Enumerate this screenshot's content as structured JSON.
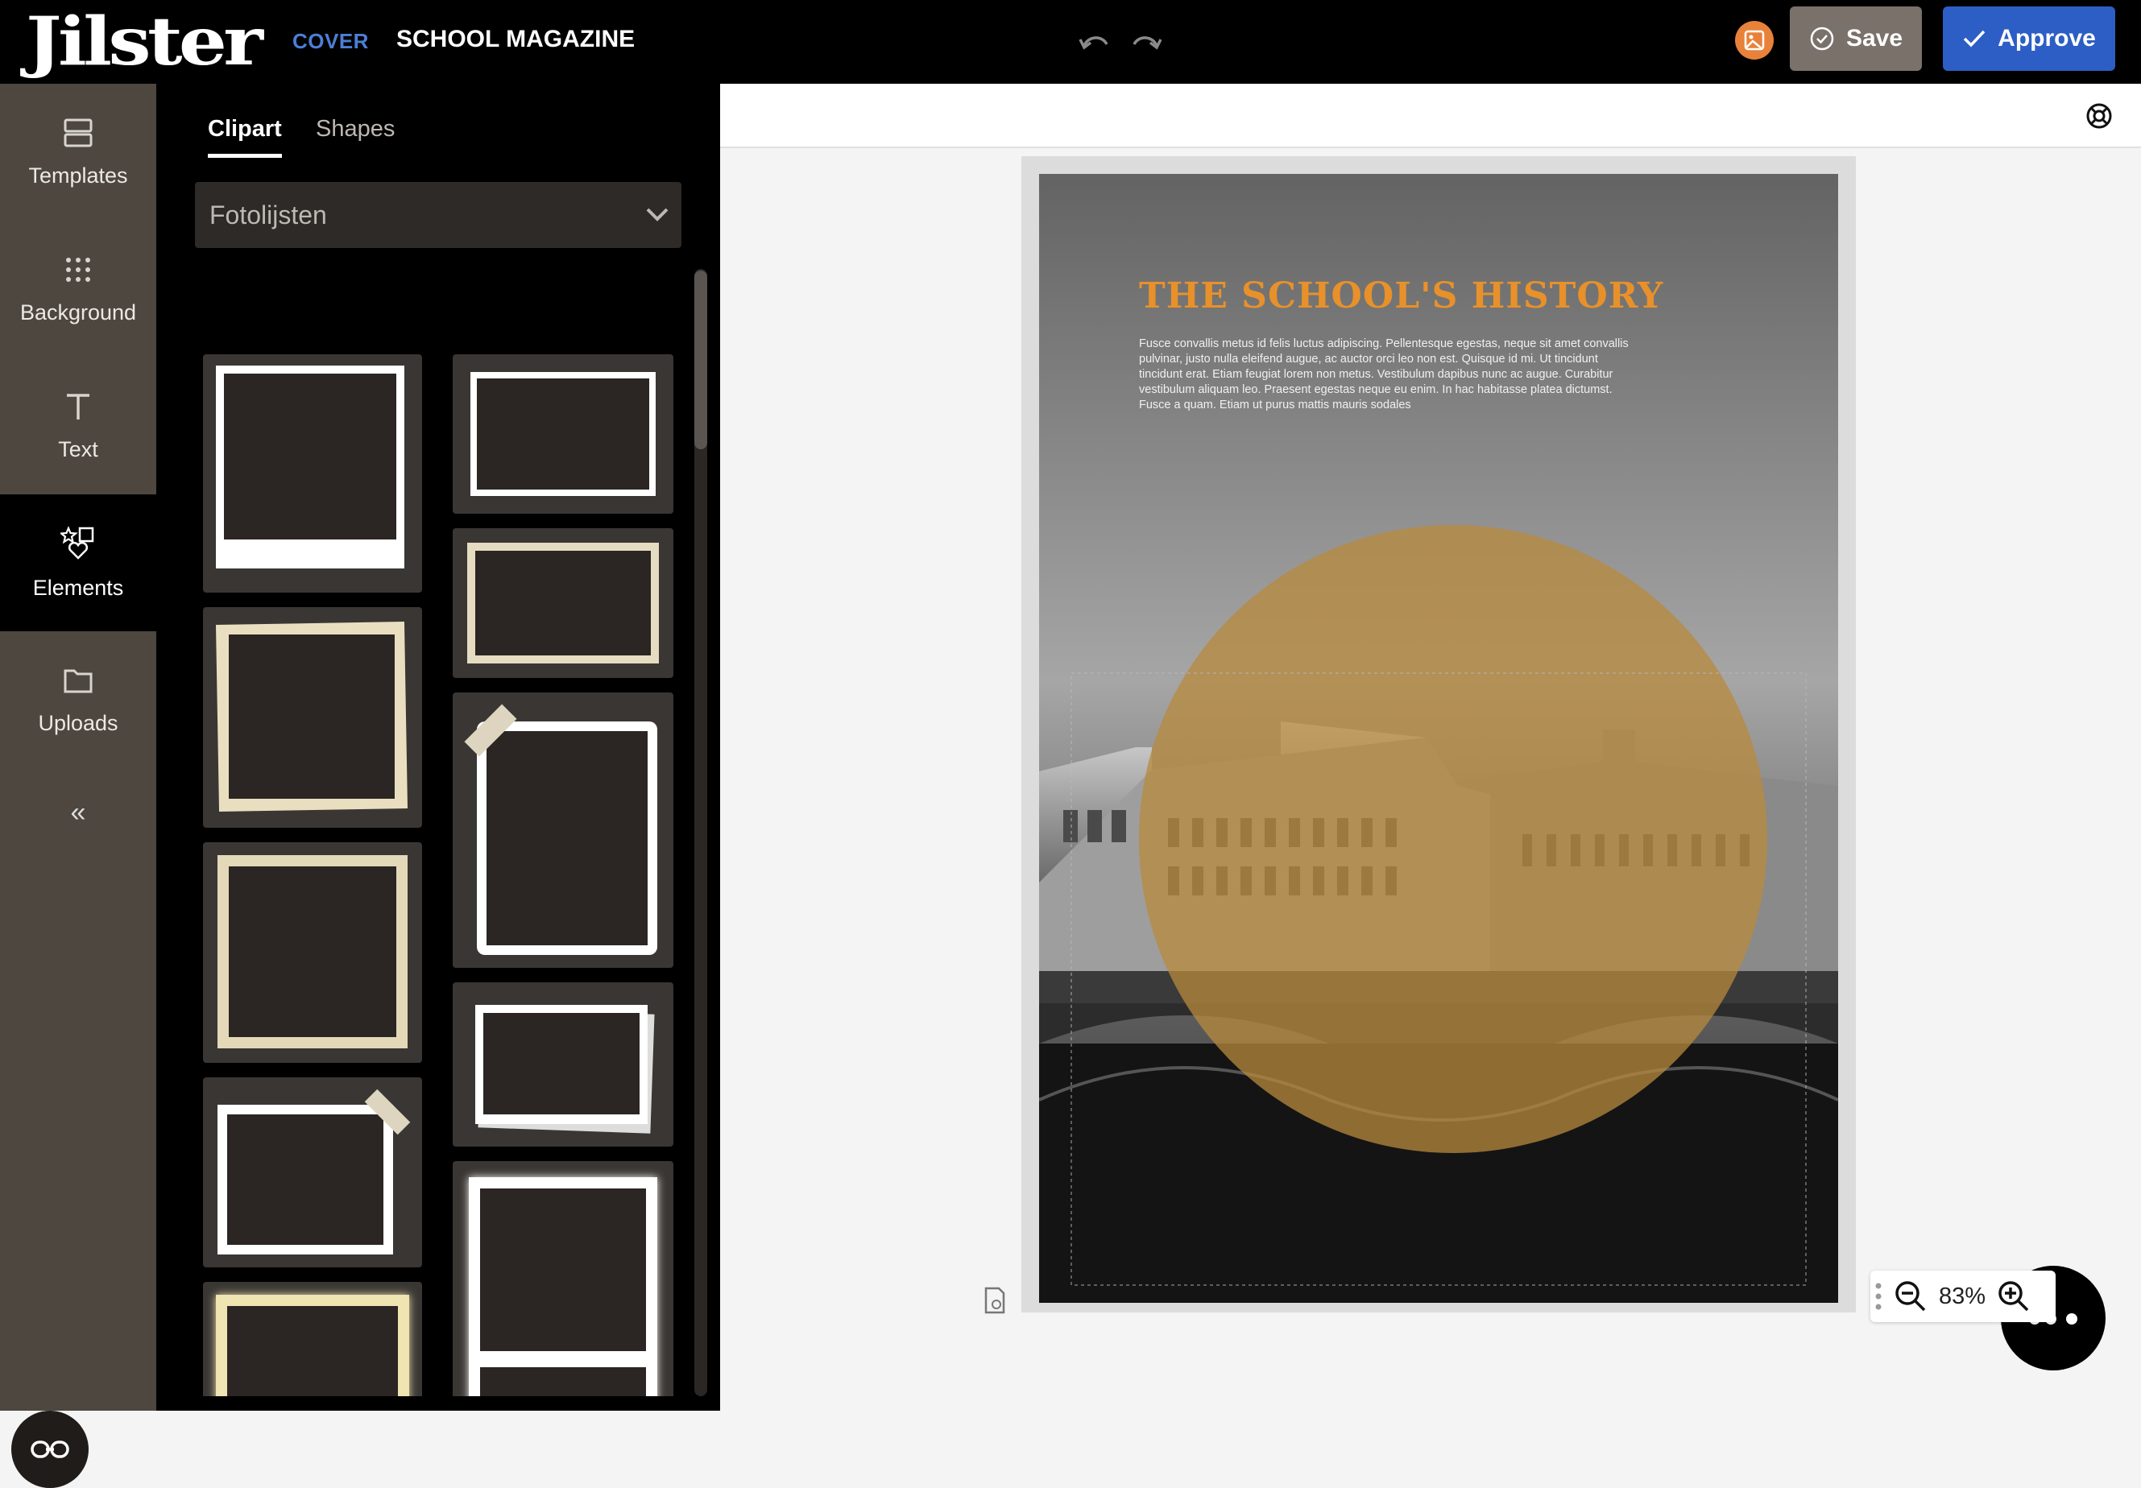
{
  "header": {
    "logo_text": "Jilster",
    "section_label": "COVER",
    "document_title": "SCHOOL MAGAZINE",
    "save_label": "Save",
    "approve_label": "Approve"
  },
  "sidebar": {
    "items": [
      {
        "label": "Templates",
        "icon": "templates-icon",
        "active": false
      },
      {
        "label": "Background",
        "icon": "background-icon",
        "active": false
      },
      {
        "label": "Text",
        "icon": "text-icon",
        "active": false
      },
      {
        "label": "Elements",
        "icon": "elements-icon",
        "active": true
      },
      {
        "label": "Uploads",
        "icon": "uploads-icon",
        "active": false
      }
    ],
    "collapse_glyph": "«"
  },
  "panel": {
    "tabs": [
      {
        "label": "Clipart",
        "active": true
      },
      {
        "label": "Shapes",
        "active": false
      }
    ],
    "category_select": {
      "value": "Fotolijsten"
    }
  },
  "page": {
    "title": "THE SCHOOL'S HISTORY",
    "body": "Fusce convallis metus id felis luctus adipiscing. Pellentesque egestas, neque sit amet convallis pulvinar, justo nulla eleifend augue, ac auctor orci leo non est. Quisque id mi. Ut tincidunt tincidunt erat. Etiam feugiat lorem non metus. Vestibulum dapibus nunc ac augue. Curabitur vestibulum aliquam leo. Praesent egestas neque eu enim. In hac habitasse platea dictumst. Fusce a quam. Etiam ut purus mattis mauris sodales"
  },
  "zoom": {
    "value": "83%"
  },
  "colors": {
    "accent_blue": "#2c5ec5",
    "cover_label": "#4d7ed6",
    "save_grey": "#7a716b",
    "title_orange": "#e8912a",
    "circle_gold": "#b88a3c"
  }
}
